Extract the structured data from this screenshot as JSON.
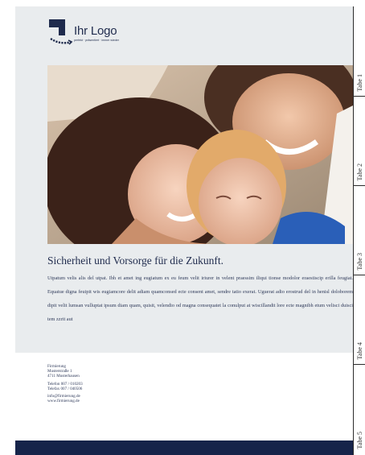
{
  "logo": {
    "title": "Ihr Logo",
    "tagline": "perfekt · präsentiert · immer wieder"
  },
  "headline": "Sicherheit und Vorsorge für die Zukunft.",
  "body": "Utpatum velis alis del utpat. Ibh et amet ing eugiatum ex eu feum velit iriurer in velent praessim iliqui tionse modolor eraestiscip erilla feugiat. Equatue digna feuipit wis eugiamcore delit adiam quamconsed ecte consent amet, sendre tatio exerat. Uguerat adio erostrud del in henisl doloborem dipit velit lumsan vulluptat ipsum diam quam, quisit, velendio od magna consequatet la conulput at wiscillandit lore ecte magnibh etum velisci duisci tem zzrit aut",
  "contact": {
    "company": "Firmierung",
    "street": "Musterstraße 1",
    "city": "4711 Musterhausen",
    "phone": "Telefon 007 / 010203",
    "fax": "Telefax 007 / 040506",
    "email": "info@firmierung.de",
    "web": "www.firmierung.de"
  },
  "tabs": [
    "Tabe 1",
    "Tabe 2",
    "Tabe 3",
    "Tabe 4",
    "Tabe 5"
  ],
  "colors": {
    "brand_navy": "#16244a",
    "panel_gray": "#e9ecee"
  }
}
